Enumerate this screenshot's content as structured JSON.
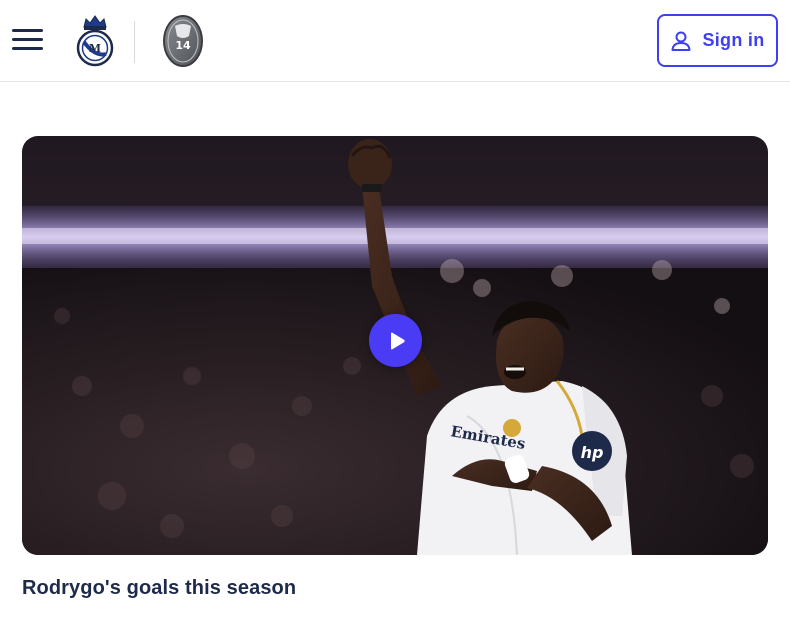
{
  "header": {
    "menu_icon": "hamburger-menu-icon",
    "crest_icon": "real-madrid-crest-icon",
    "trophy_icon": "champions-league-14-trophy-icon",
    "trophy_number": "14",
    "signin": {
      "label": "Sign in",
      "icon": "user-icon",
      "accent": "#3d3ff0"
    }
  },
  "video": {
    "play_icon": "play-icon",
    "play_color": "#4a3cf5",
    "caption": "Rodrygo's goals this season"
  }
}
